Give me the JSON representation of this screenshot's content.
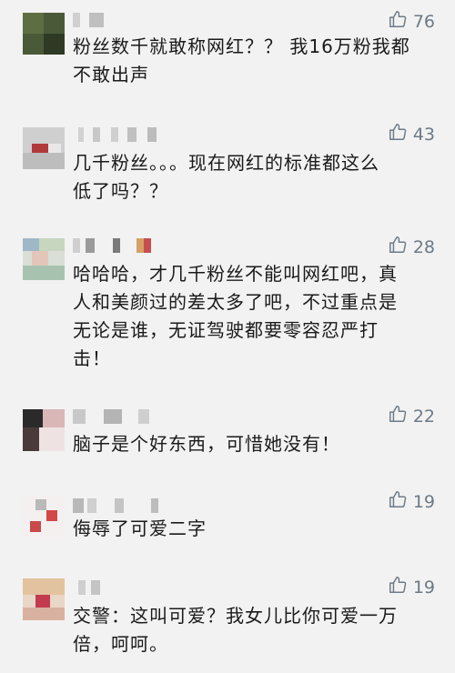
{
  "comments": [
    {
      "likes": "76",
      "text": "粉丝数千就敢称网红？？ 我16万粉我都\n不敢出声"
    },
    {
      "likes": "43",
      "text": "几千粉丝。。。现在网红的标准都这么\n低了吗？？"
    },
    {
      "likes": "28",
      "text": "哈哈哈，才几千粉丝不能叫网红吧，真\n人和美颜过的差太多了吧，不过重点是\n无论是谁，无证驾驶都要零容忍严打\n击！"
    },
    {
      "likes": "22",
      "text": "脑子是个好东西，可惜她没有！"
    },
    {
      "likes": "19",
      "text": "侮辱了可爱二字"
    },
    {
      "likes": "19",
      "text": "交警：这叫可爱？我女儿比你可爱一万\n倍，呵呵。"
    }
  ],
  "icons": {
    "like": "thumbs-up-icon"
  },
  "colors": {
    "background": "#f2f2f2",
    "like_color": "#6d7a86",
    "text": "#1a1a1a"
  }
}
